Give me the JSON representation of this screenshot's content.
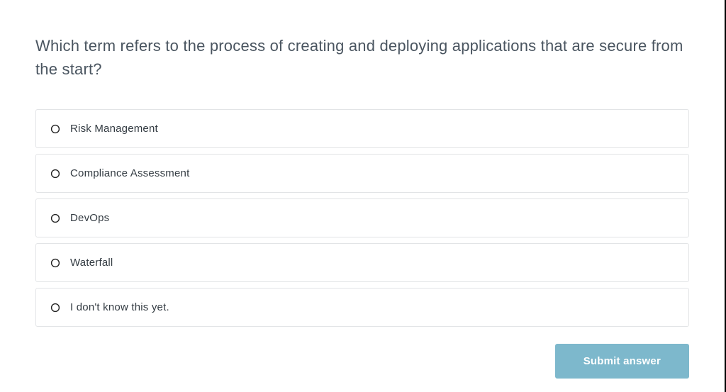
{
  "question": {
    "text": "Which term refers to the process of creating and deploying applications that are secure from the start?"
  },
  "options": [
    {
      "label": "Risk Management"
    },
    {
      "label": "Compliance Assessment"
    },
    {
      "label": "DevOps"
    },
    {
      "label": "Waterfall"
    },
    {
      "label": "I don't know this yet."
    }
  ],
  "submit": {
    "label": "Submit answer"
  }
}
